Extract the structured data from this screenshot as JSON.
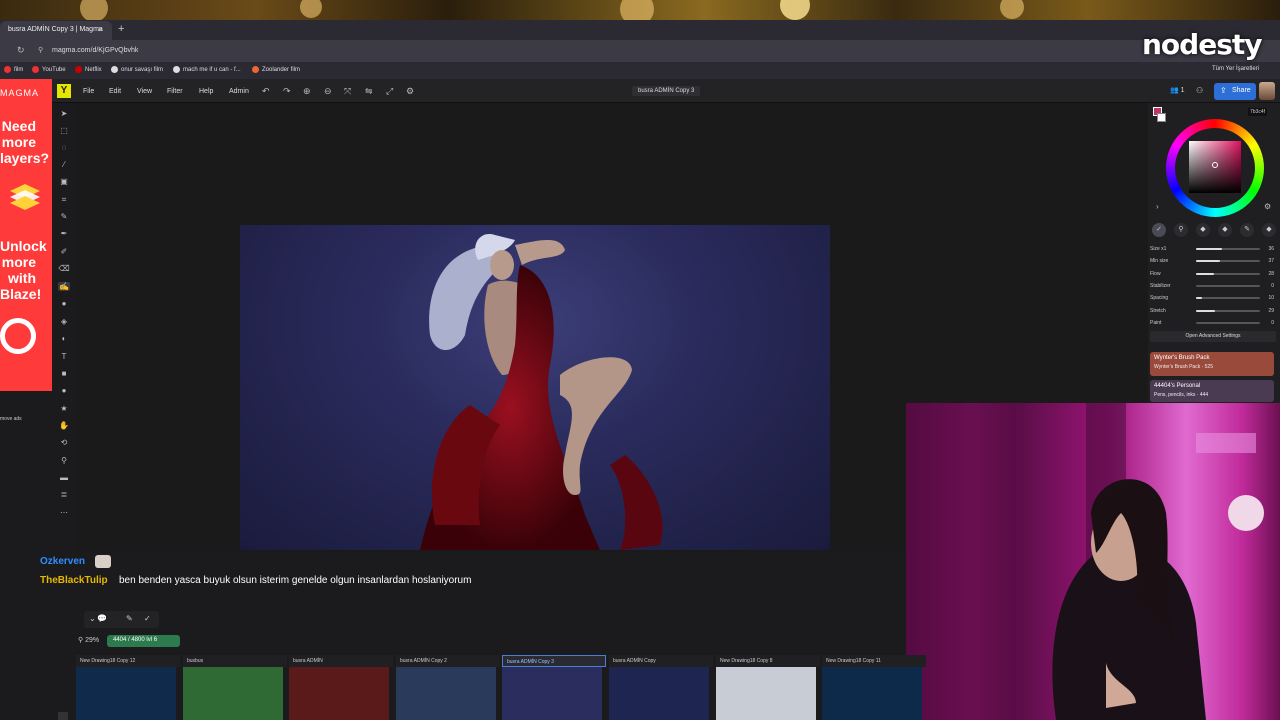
{
  "browser": {
    "tab_title": "busra ADMİN Copy 3 | Magma",
    "tab_close": "×",
    "new_tab": "+",
    "url": "magma.com/d/KjGPvQbvhk",
    "bookmarks": [
      {
        "label": "film",
        "color": "#e33"
      },
      {
        "label": "YouTube",
        "color": "#e33"
      },
      {
        "label": "Netflix",
        "color": "#c00"
      },
      {
        "label": "onur savaşı film",
        "color": "#ddd"
      },
      {
        "label": "mach me if u can - f...",
        "color": "#ddd"
      },
      {
        "label": "Zoolander film",
        "color": "#e63"
      }
    ],
    "bookmarks_right": "Tüm Yer İşaretleri"
  },
  "stream_logo": "nodesty",
  "ad": {
    "brand": "MAGMA",
    "text_top": [
      "Need",
      "more",
      "layers?"
    ],
    "text_bottom": [
      "Unlock",
      "more",
      "with",
      "Blaze!"
    ],
    "remove_ads": "move ads"
  },
  "app": {
    "logo": "Y",
    "menu": [
      "File",
      "Edit",
      "View",
      "Filter",
      "Help",
      "Admin"
    ],
    "doc_title": "busra ADMİN Copy 3",
    "users_count": "1",
    "share_label": "Share"
  },
  "color_panel": {
    "hex": "7b3c4f",
    "fg_color": "#c0325f",
    "bg_color": "#ffffff"
  },
  "brush_sliders": [
    {
      "label": "Size x1",
      "value": "36",
      "fill": 0.4
    },
    {
      "label": "Min size",
      "value": "37",
      "fill": 0.37
    },
    {
      "label": "Flow",
      "value": "28",
      "fill": 0.28
    },
    {
      "label": "Stabilizer",
      "value": "0",
      "fill": 0.0
    },
    {
      "label": "Spacing",
      "value": "10",
      "fill": 0.1
    },
    {
      "label": "Stretch",
      "value": "29",
      "fill": 0.29
    },
    {
      "label": "Paint",
      "value": "0",
      "fill": 0.0
    }
  ],
  "advanced_settings": "Open Advanced Settings",
  "brush_packs": [
    {
      "title": "Wynter's Brush Pack",
      "sub": "Wynter's Brush Pack · 525",
      "color": "#9a4a3a"
    },
    {
      "title": "44404's Personal",
      "sub": "Pens, pencils, inks · 444",
      "color": "#4a3a52"
    }
  ],
  "chat": [
    {
      "user": "Ozkerven",
      "message": "",
      "user_color": "#2d8fff"
    },
    {
      "user": "TheBlackTulip",
      "message": "ben benden yasca buyuk olsun isterim genelde olgun insanlardan hoslaniyorum",
      "user_color": "#e6b800"
    }
  ],
  "status": {
    "zoom": "29%",
    "layers": "4404 / 4800",
    "level": "lvl 6"
  },
  "thumbnails": [
    {
      "label": "New Drawing18 Copy 12",
      "color": "#0f2a4a",
      "active": false
    },
    {
      "label": "busbus",
      "color": "#2f6a34",
      "active": false
    },
    {
      "label": "busra ADMİN",
      "color": "#5a1a1a",
      "active": false
    },
    {
      "label": "busra ADMİN Copy 2",
      "color": "#2a3a5a",
      "active": false
    },
    {
      "label": "busra ADMİN Copy 3",
      "color": "#2a2d5e",
      "active": true
    },
    {
      "label": "busra ADMİN Copy",
      "color": "#1e2550",
      "active": false
    },
    {
      "label": "New Drawing18 Copy 8",
      "color": "#c8ccd4",
      "active": false
    },
    {
      "label": "New Drawing18 Copy 11",
      "color": "#0e2a4a",
      "active": false
    }
  ]
}
